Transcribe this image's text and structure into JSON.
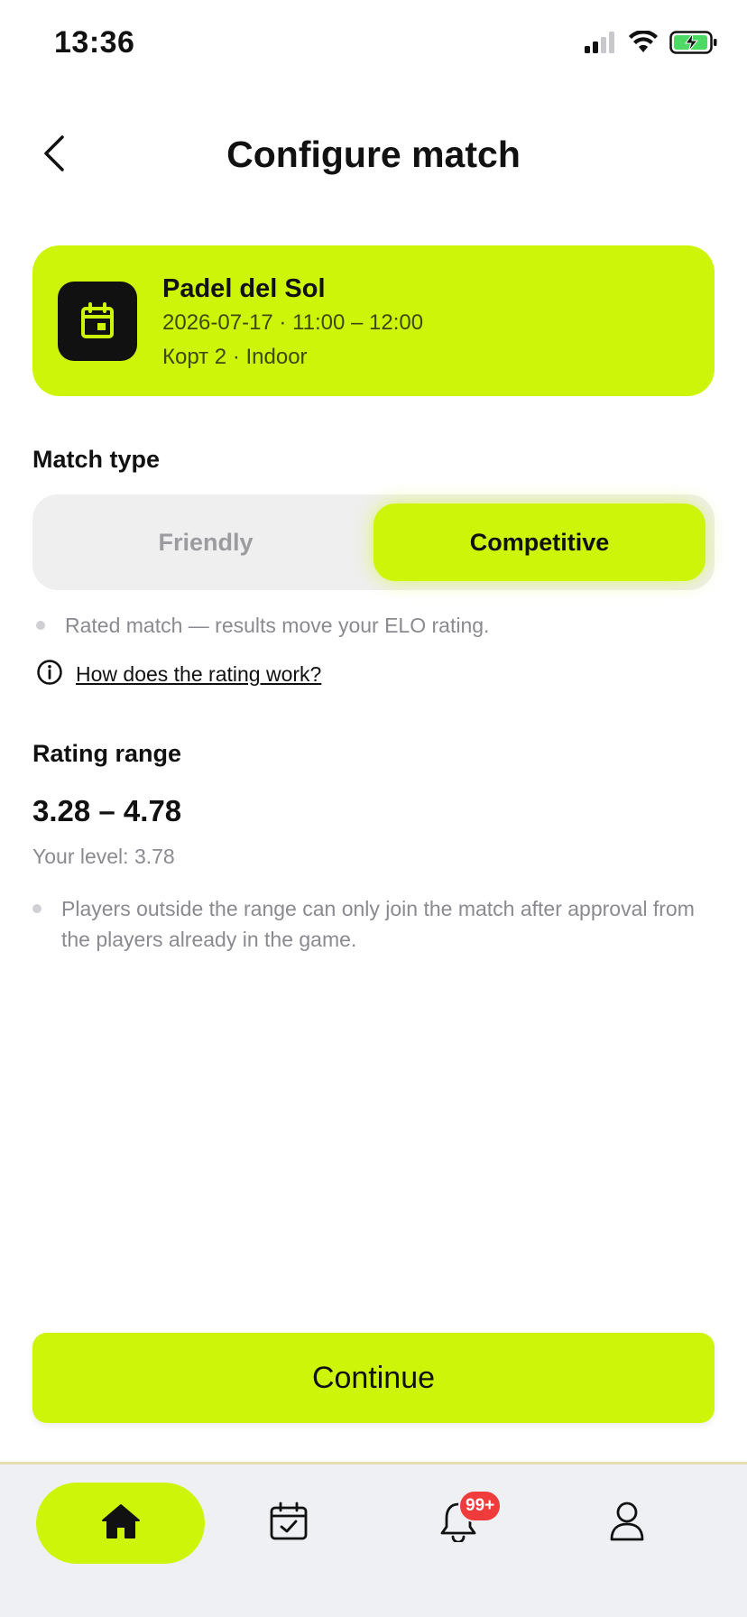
{
  "status_bar": {
    "time": "13:36",
    "icons": [
      "signal-icon",
      "wifi-icon",
      "battery-charging-icon"
    ]
  },
  "header": {
    "title": "Configure match",
    "back_icon": "chevron-left-icon"
  },
  "booking": {
    "icon": "calendar-icon",
    "venue": "Padel del Sol",
    "datetime": "2026-07-17 · 11:00 – 12:00",
    "court": "Корт 2 · Indoor"
  },
  "match_type": {
    "label": "Match type",
    "options": [
      "Friendly",
      "Competitive"
    ],
    "selected": "Competitive",
    "description": "Rated match — results move your ELO rating.",
    "info_link": "How does the rating work?"
  },
  "rating_range": {
    "label": "Rating range",
    "value": "3.28 – 4.78",
    "your_level": "Your level: 3.78",
    "note": "Players outside the range can only join the match after approval from the players already in the game."
  },
  "continue_button": "Continue",
  "tab_bar": {
    "tabs": [
      "home-icon",
      "calendar-check-icon",
      "bell-icon",
      "profile-icon"
    ],
    "active": "home",
    "notification_badge": "99+"
  },
  "colors": {
    "accent": "#cdf50a",
    "badge": "#ef3b3b",
    "muted_text": "#8a8a90",
    "tab_bar_bg": "#eff0f4"
  }
}
